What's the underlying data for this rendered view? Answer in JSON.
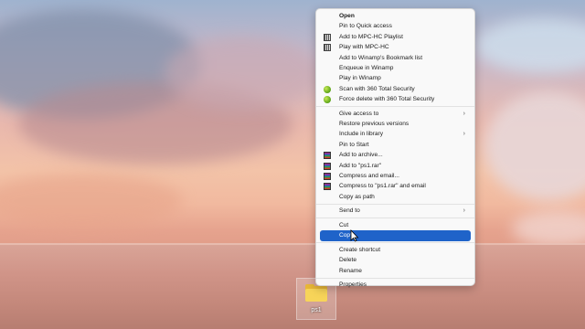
{
  "desktop": {
    "icon_label": "ps1"
  },
  "context_menu": {
    "groups": [
      [
        {
          "label": "Open",
          "bold": true,
          "icon": "",
          "submenu": false
        },
        {
          "label": "Pin to Quick access",
          "icon": "",
          "submenu": false
        },
        {
          "label": "Add to MPC-HC Playlist",
          "icon": "mpc-hc-icon",
          "submenu": false
        },
        {
          "label": "Play with MPC-HC",
          "icon": "mpc-hc-icon",
          "submenu": false
        },
        {
          "label": "Add to Winamp's Bookmark list",
          "icon": "",
          "submenu": false
        },
        {
          "label": "Enqueue in Winamp",
          "icon": "",
          "submenu": false
        },
        {
          "label": "Play in Winamp",
          "icon": "",
          "submenu": false
        },
        {
          "label": "Scan with 360 Total Security",
          "icon": "360-security-icon",
          "submenu": false
        },
        {
          "label": "Force delete with 360 Total Security",
          "icon": "360-security-icon",
          "submenu": false
        }
      ],
      [
        {
          "label": "Give access to",
          "icon": "",
          "submenu": true
        },
        {
          "label": "Restore previous versions",
          "icon": "",
          "submenu": false
        },
        {
          "label": "Include in library",
          "icon": "",
          "submenu": true
        },
        {
          "label": "Pin to Start",
          "icon": "",
          "submenu": false
        },
        {
          "label": "Add to archive...",
          "icon": "winrar-icon",
          "submenu": false
        },
        {
          "label": "Add to \"ps1.rar\"",
          "icon": "winrar-icon",
          "submenu": false
        },
        {
          "label": "Compress and email...",
          "icon": "winrar-icon",
          "submenu": false
        },
        {
          "label": "Compress to \"ps1.rar\" and email",
          "icon": "winrar-icon",
          "submenu": false
        },
        {
          "label": "Copy as path",
          "icon": "",
          "submenu": false
        }
      ],
      [
        {
          "label": "Send to",
          "icon": "",
          "submenu": true
        }
      ],
      [
        {
          "label": "Cut",
          "icon": "",
          "submenu": false
        },
        {
          "label": "Copy",
          "icon": "",
          "submenu": false,
          "highlighted": true
        }
      ],
      [
        {
          "label": "Create shortcut",
          "icon": "",
          "submenu": false
        },
        {
          "label": "Delete",
          "icon": "",
          "submenu": false
        },
        {
          "label": "Rename",
          "icon": "",
          "submenu": false
        }
      ],
      [
        {
          "label": "Properties",
          "icon": "",
          "submenu": false
        }
      ]
    ],
    "submenu_arrow": "›",
    "highlight_color": "#1f63c9"
  }
}
